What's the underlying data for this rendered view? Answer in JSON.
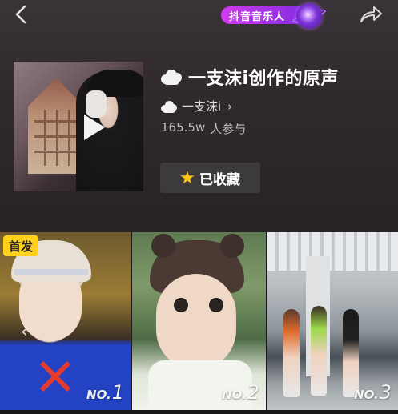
{
  "header": {
    "brand_label": "抖音音乐人",
    "accent_color": "#b83cf0"
  },
  "song": {
    "title": "一支沫i创作的原声",
    "artist": "一支沫i",
    "participant_count": "165.5w",
    "participant_suffix": "人参与",
    "favorite_label": "已收藏"
  },
  "videos": [
    {
      "badge": "首发",
      "rank_prefix": "NO.",
      "rank": "1"
    },
    {
      "badge": "",
      "rank_prefix": "NO.",
      "rank": "2"
    },
    {
      "badge": "",
      "rank_prefix": "NO.",
      "rank": "3"
    }
  ],
  "icons": {
    "back": "chevron-left-icon",
    "share": "share-arrow-icon",
    "play": "play-icon",
    "favorite": "star-icon"
  }
}
